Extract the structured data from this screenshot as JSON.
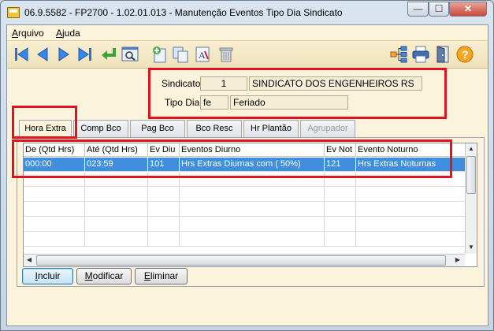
{
  "window": {
    "title": "06.9.5582 - FP2700 - 1.02.01.013 - Manutenção Eventos Tipo Dia Sindicato",
    "min_label": "—",
    "max_label": "☐",
    "close_label": "✕"
  },
  "menu": {
    "items": [
      {
        "label_ul": "A",
        "label_rest": "rquivo"
      },
      {
        "label_ul": "A",
        "label_rest": "juda"
      }
    ]
  },
  "toolbar": {
    "icons": [
      "first-record-icon",
      "previous-record-icon",
      "next-record-icon",
      "last-record-icon",
      "return-icon",
      "search-icon",
      "new-document-icon",
      "copy-icon",
      "text-format-icon",
      "trash-icon",
      "tree-structure-icon",
      "print-icon",
      "exit-door-icon",
      "help-icon"
    ],
    "help_glyph": "?",
    "text_format_glyph": "A"
  },
  "header": {
    "sindicato_label": "Sindicato:",
    "sindicato_code": "1",
    "sindicato_name": "SINDICATO DOS ENGENHEIROS RS",
    "tipo_dia_label": "Tipo Dia:",
    "tipo_dia_code": "fe",
    "tipo_dia_name": "Feriado"
  },
  "tabs": [
    {
      "label": "Hora Extra",
      "active": true,
      "disabled": false
    },
    {
      "label": "Comp Bco",
      "active": false,
      "disabled": false
    },
    {
      "label": "Pag Bco",
      "active": false,
      "disabled": false
    },
    {
      "label": "Bco Resc",
      "active": false,
      "disabled": false
    },
    {
      "label": "Hr Plantão",
      "active": false,
      "disabled": false
    },
    {
      "label": "Agrupador",
      "active": false,
      "disabled": true
    }
  ],
  "grid": {
    "columns": [
      "De (Qtd Hrs)",
      "Até (Qtd Hrs)",
      "Ev Diu",
      "Eventos Diurno",
      "Ev Not",
      "Evento Noturno"
    ],
    "rows": [
      [
        "000:00",
        "023:59",
        "101",
        "Hrs Extras Diurnas  com ( 50%)",
        "121",
        "Hrs Extras Noturnas"
      ]
    ]
  },
  "buttons": {
    "incluir": "Incluir",
    "incluir_ul": "I",
    "incluir_rest": "ncluir",
    "modificar_ul": "M",
    "modificar_rest": "odificar",
    "eliminar_ul": "E",
    "eliminar_rest": "liminar"
  },
  "colors": {
    "highlight_red": "#e0141e",
    "selection_blue": "#3f8fde",
    "panel_beige": "#fbf3dc"
  }
}
